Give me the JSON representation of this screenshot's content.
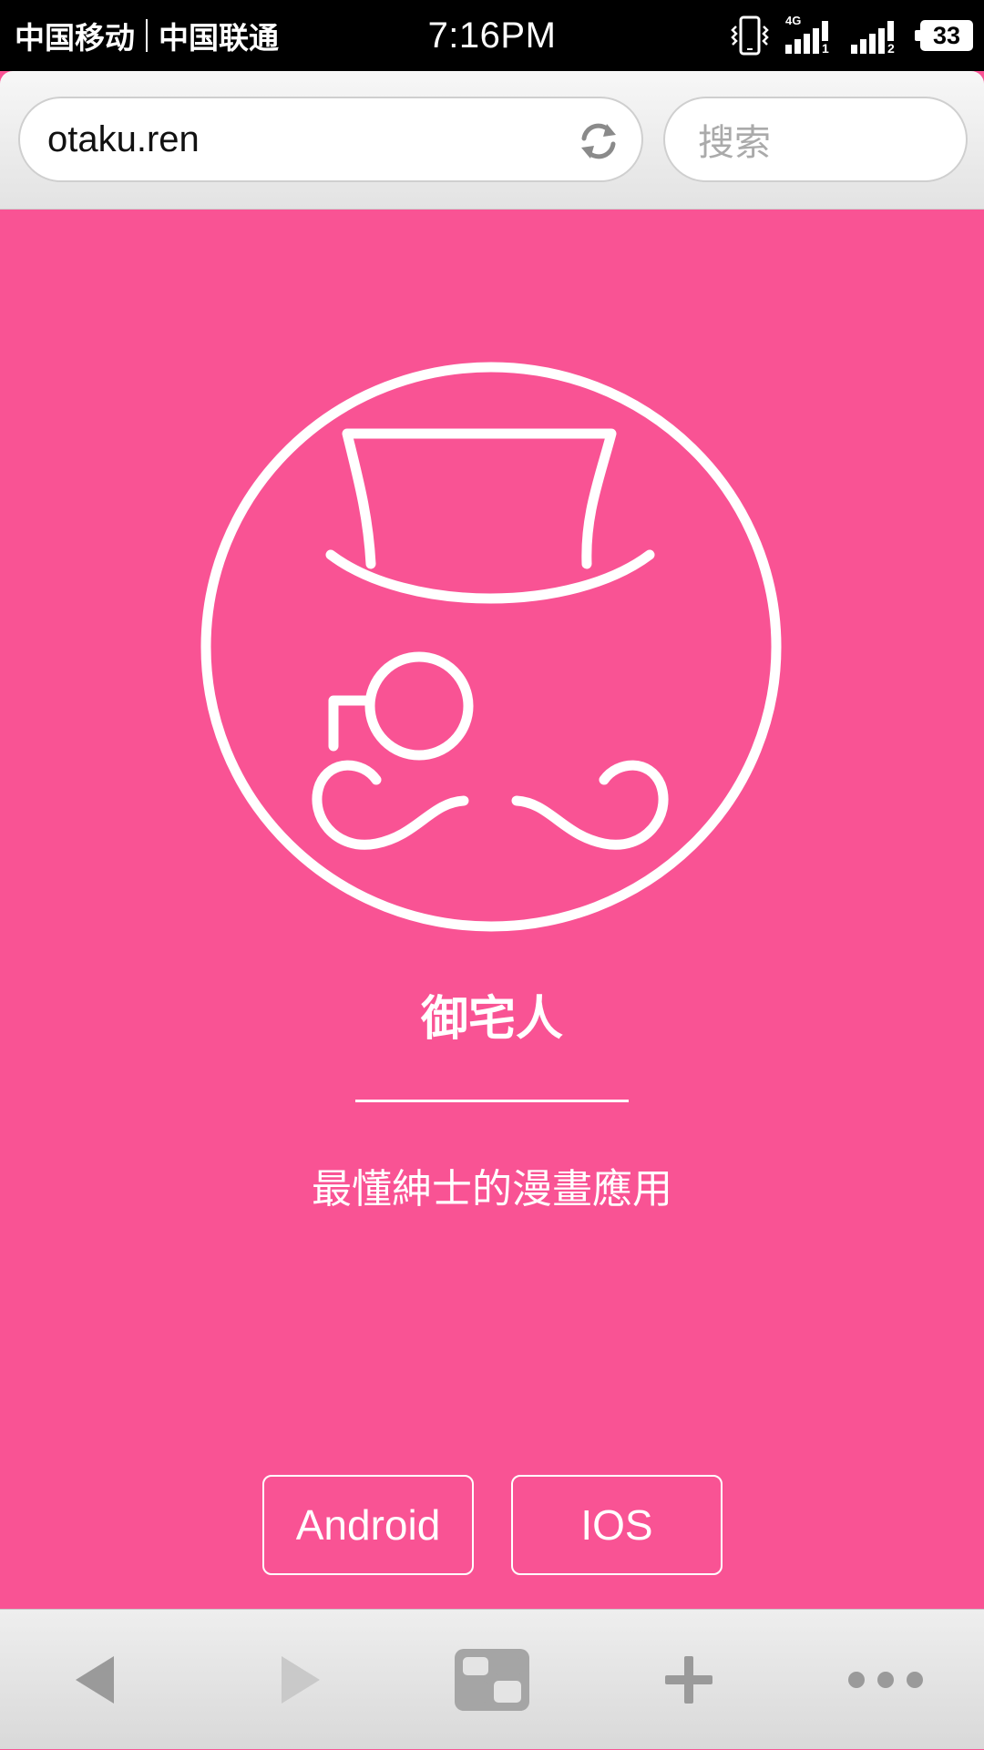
{
  "status_bar": {
    "carrier_1": "中国移动",
    "carrier_2": "中国联通",
    "time": "7:16PM",
    "network": "4G",
    "sim_1_label": "1",
    "sim_2_label": "2",
    "battery_level": "33"
  },
  "browser": {
    "url": "otaku.ren",
    "search_placeholder": "搜索"
  },
  "page": {
    "app_name": "御宅人",
    "tagline": "最懂紳士的漫畫應用",
    "buttons": {
      "android": "Android",
      "ios": "IOS"
    },
    "background_color": "#f95394",
    "foreground_color": "#ffffff"
  },
  "toolbar": {
    "icons": [
      "back-icon",
      "forward-icon",
      "tabs-icon",
      "add-icon",
      "more-icon"
    ]
  }
}
